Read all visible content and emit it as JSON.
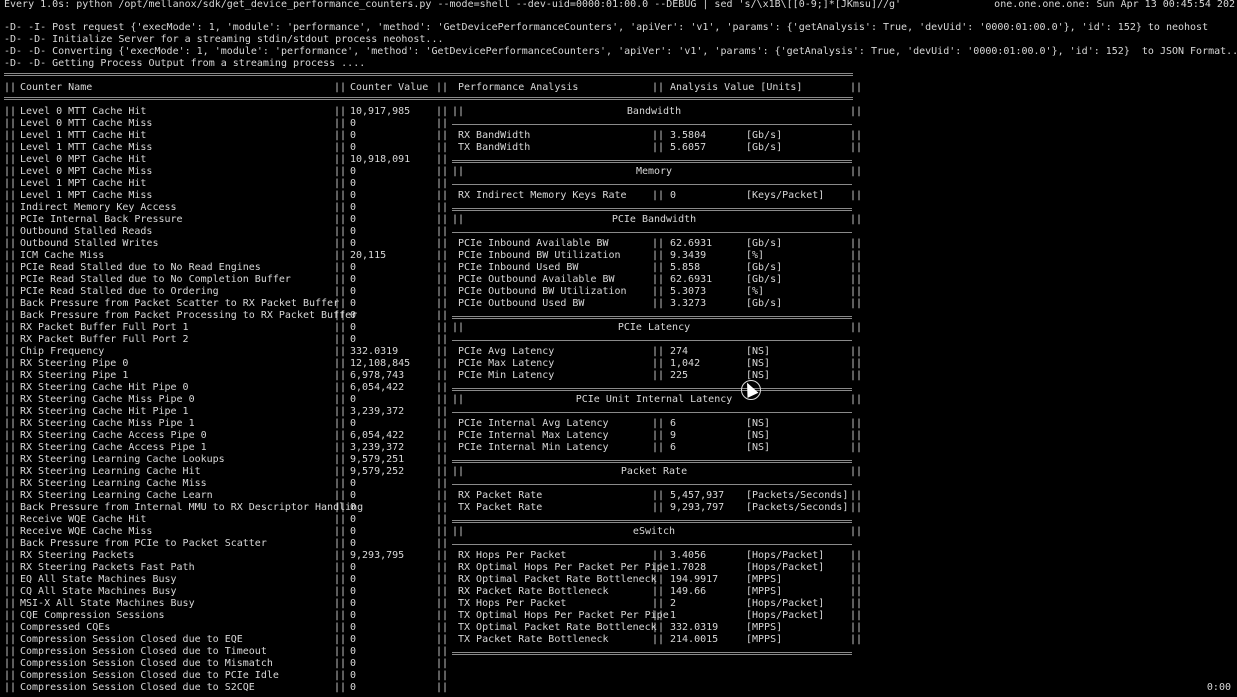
{
  "header": {
    "watch_line": "Every 1.0s: python /opt/mellanox/sdk/get_device_performance_counters.py --mode=shell --dev-uid=0000:01:00.0 --DEBUG | sed 's/\\x1B\\[[0-9;]*[JKmsu]//g'",
    "host_time": "one.one.one.one: Sun Apr 13 00:45:54 202",
    "debug_lines": [
      "-D- -I- Post request {'execMode': 1, 'module': 'performance', 'method': 'GetDevicePerformanceCounters', 'apiVer': 'v1', 'params': {'getAnalysis': True, 'devUid': '0000:01:00.0'}, 'id': 152} to neohost",
      "-D- -D- Initialize Server for a streaming stdin/stdout process neohost...",
      "-D- -D- Converting {'execMode': 1, 'module': 'performance', 'method': 'GetDevicePerformanceCounters', 'apiVer': 'v1', 'params': {'getAnalysis': True, 'devUid': '0000:01:00.0'}, 'id': 152}  to JSON Format...",
      "-D- -D- Getting Process Output from a streaming process ...."
    ]
  },
  "table_header": {
    "counter_name": "Counter Name",
    "counter_value": "Counter Value",
    "performance_analysis": "Performance Analysis",
    "analysis_value": "Analysis Value [Units]"
  },
  "counters": [
    {
      "name": "Level 0 MTT Cache Hit",
      "value": "10,917,985"
    },
    {
      "name": "Level 0 MTT Cache Miss",
      "value": "0"
    },
    {
      "name": "Level 1 MTT Cache Hit",
      "value": "0"
    },
    {
      "name": "Level 1 MTT Cache Miss",
      "value": "0"
    },
    {
      "name": "Level 0 MPT Cache Hit",
      "value": "10,918,091"
    },
    {
      "name": "Level 0 MPT Cache Miss",
      "value": "0"
    },
    {
      "name": "Level 1 MPT Cache Hit",
      "value": "0"
    },
    {
      "name": "Level 1 MPT Cache Miss",
      "value": "0"
    },
    {
      "name": "Indirect Memory Key Access",
      "value": "0"
    },
    {
      "name": "PCIe Internal Back Pressure",
      "value": "0"
    },
    {
      "name": "Outbound Stalled Reads",
      "value": "0"
    },
    {
      "name": "Outbound Stalled Writes",
      "value": "0"
    },
    {
      "name": "ICM Cache Miss",
      "value": "20,115"
    },
    {
      "name": "PCIe Read Stalled due to No Read Engines",
      "value": "0"
    },
    {
      "name": "PCIe Read Stalled due to No Completion Buffer",
      "value": "0"
    },
    {
      "name": "PCIe Read Stalled due to Ordering",
      "value": "0"
    },
    {
      "name": "Back Pressure from Packet Scatter to RX Packet Buffer",
      "value": "0"
    },
    {
      "name": "Back Pressure from Packet Processing to RX Packet Buffer",
      "value": "0"
    },
    {
      "name": "RX Packet Buffer Full Port 1",
      "value": "0"
    },
    {
      "name": "RX Packet Buffer Full Port 2",
      "value": "0"
    },
    {
      "name": "Chip Frequency",
      "value": "332.0319"
    },
    {
      "name": "RX Steering Pipe 0",
      "value": "12,108,845"
    },
    {
      "name": "RX Steering Pipe 1",
      "value": "6,978,743"
    },
    {
      "name": "RX Steering Cache Hit Pipe 0",
      "value": "6,054,422"
    },
    {
      "name": "RX Steering Cache Miss Pipe 0",
      "value": "0"
    },
    {
      "name": "RX Steering Cache Hit Pipe 1",
      "value": "3,239,372"
    },
    {
      "name": "RX Steering Cache Miss Pipe 1",
      "value": "0"
    },
    {
      "name": "RX Steering Cache Access Pipe 0",
      "value": "6,054,422"
    },
    {
      "name": "RX Steering Cache Access Pipe 1",
      "value": "3,239,372"
    },
    {
      "name": "RX Steering Learning Cache Lookups",
      "value": "9,579,251"
    },
    {
      "name": "RX Steering Learning Cache Hit",
      "value": "9,579,252"
    },
    {
      "name": "RX Steering Learning Cache Miss",
      "value": "0"
    },
    {
      "name": "RX Steering Learning Cache Learn",
      "value": "0"
    },
    {
      "name": "Back Pressure from Internal MMU to RX Descriptor Handling",
      "value": "0"
    },
    {
      "name": "Receive WQE Cache Hit",
      "value": "0"
    },
    {
      "name": "Receive WQE Cache Miss",
      "value": "0"
    },
    {
      "name": "Back Pressure from PCIe to Packet Scatter",
      "value": "0"
    },
    {
      "name": "RX Steering Packets",
      "value": "9,293,795"
    },
    {
      "name": "RX Steering Packets Fast Path",
      "value": "0"
    },
    {
      "name": "EQ All State Machines Busy",
      "value": "0"
    },
    {
      "name": "CQ All State Machines Busy",
      "value": "0"
    },
    {
      "name": "MSI-X All State Machines Busy",
      "value": "0"
    },
    {
      "name": "CQE Compression Sessions",
      "value": "0"
    },
    {
      "name": "Compressed CQEs",
      "value": "0"
    },
    {
      "name": "Compression Session Closed due to EQE",
      "value": "0"
    },
    {
      "name": "Compression Session Closed due to Timeout",
      "value": "0"
    },
    {
      "name": "Compression Session Closed due to Mismatch",
      "value": "0"
    },
    {
      "name": "Compression Session Closed due to PCIe Idle",
      "value": "0"
    },
    {
      "name": "Compression Session Closed due to S2CQE",
      "value": "0"
    }
  ],
  "analysis": [
    {
      "row": 0,
      "section": "Bandwidth"
    },
    {
      "row": 2,
      "name": "RX BandWidth",
      "value": "3.5804",
      "unit": "[Gb/s]"
    },
    {
      "row": 3,
      "name": "TX BandWidth",
      "value": "5.6057",
      "unit": "[Gb/s]"
    },
    {
      "row": 5,
      "section": "Memory"
    },
    {
      "row": 7,
      "name": "RX Indirect Memory Keys Rate",
      "value": "0",
      "unit": "[Keys/Packet]"
    },
    {
      "row": 9,
      "section": "PCIe Bandwidth"
    },
    {
      "row": 11,
      "name": "PCIe Inbound Available BW",
      "value": "62.6931",
      "unit": "[Gb/s]"
    },
    {
      "row": 12,
      "name": "PCIe Inbound BW Utilization",
      "value": "9.3439",
      "unit": "[%]"
    },
    {
      "row": 13,
      "name": "PCIe Inbound Used BW",
      "value": "5.858",
      "unit": "[Gb/s]"
    },
    {
      "row": 14,
      "name": "PCIe Outbound Available BW",
      "value": "62.6931",
      "unit": "[Gb/s]"
    },
    {
      "row": 15,
      "name": "PCIe Outbound BW Utilization",
      "value": "5.3073",
      "unit": "[%]"
    },
    {
      "row": 16,
      "name": "PCIe Outbound Used BW",
      "value": "3.3273",
      "unit": "[Gb/s]"
    },
    {
      "row": 18,
      "section": "PCIe Latency"
    },
    {
      "row": 20,
      "name": "PCIe Avg Latency",
      "value": "274",
      "unit": "[NS]"
    },
    {
      "row": 21,
      "name": "PCIe Max Latency",
      "value": "1,042",
      "unit": "[NS]"
    },
    {
      "row": 22,
      "name": "PCIe Min Latency",
      "value": "225",
      "unit": "[NS]"
    },
    {
      "row": 24,
      "section": "PCIe Unit Internal Latency"
    },
    {
      "row": 26,
      "name": "PCIe Internal Avg Latency",
      "value": "6",
      "unit": "[NS]"
    },
    {
      "row": 27,
      "name": "PCIe Internal Max Latency",
      "value": "9",
      "unit": "[NS]"
    },
    {
      "row": 28,
      "name": "PCIe Internal Min Latency",
      "value": "6",
      "unit": "[NS]"
    },
    {
      "row": 30,
      "section": "Packet Rate"
    },
    {
      "row": 32,
      "name": "RX Packet Rate",
      "value": "5,457,937",
      "unit": "[Packets/Seconds]"
    },
    {
      "row": 33,
      "name": "TX Packet Rate",
      "value": "9,293,797",
      "unit": "[Packets/Seconds]"
    },
    {
      "row": 35,
      "section": "eSwitch"
    },
    {
      "row": 37,
      "name": "RX Hops Per Packet",
      "value": "3.4056",
      "unit": "[Hops/Packet]"
    },
    {
      "row": 38,
      "name": "RX Optimal Hops Per Packet Per Pipe",
      "value": "1.7028",
      "unit": "[Hops/Packet]"
    },
    {
      "row": 39,
      "name": "RX Optimal Packet Rate Bottleneck",
      "value": "194.9917",
      "unit": "[MPPS]"
    },
    {
      "row": 40,
      "name": "RX Packet Rate Bottleneck",
      "value": "149.66",
      "unit": "[MPPS]"
    },
    {
      "row": 41,
      "name": "TX Hops Per Packet",
      "value": "2",
      "unit": "[Hops/Packet]"
    },
    {
      "row": 42,
      "name": "TX Optimal Hops Per Packet Per Pipe",
      "value": "1",
      "unit": "[Hops/Packet]"
    },
    {
      "row": 43,
      "name": "TX Optimal Packet Rate Bottleneck",
      "value": "332.0319",
      "unit": "[MPPS]"
    },
    {
      "row": 44,
      "name": "TX Packet Rate Bottleneck",
      "value": "214.0015",
      "unit": "[MPPS]"
    }
  ],
  "pipe": "||",
  "timer": "0:00"
}
